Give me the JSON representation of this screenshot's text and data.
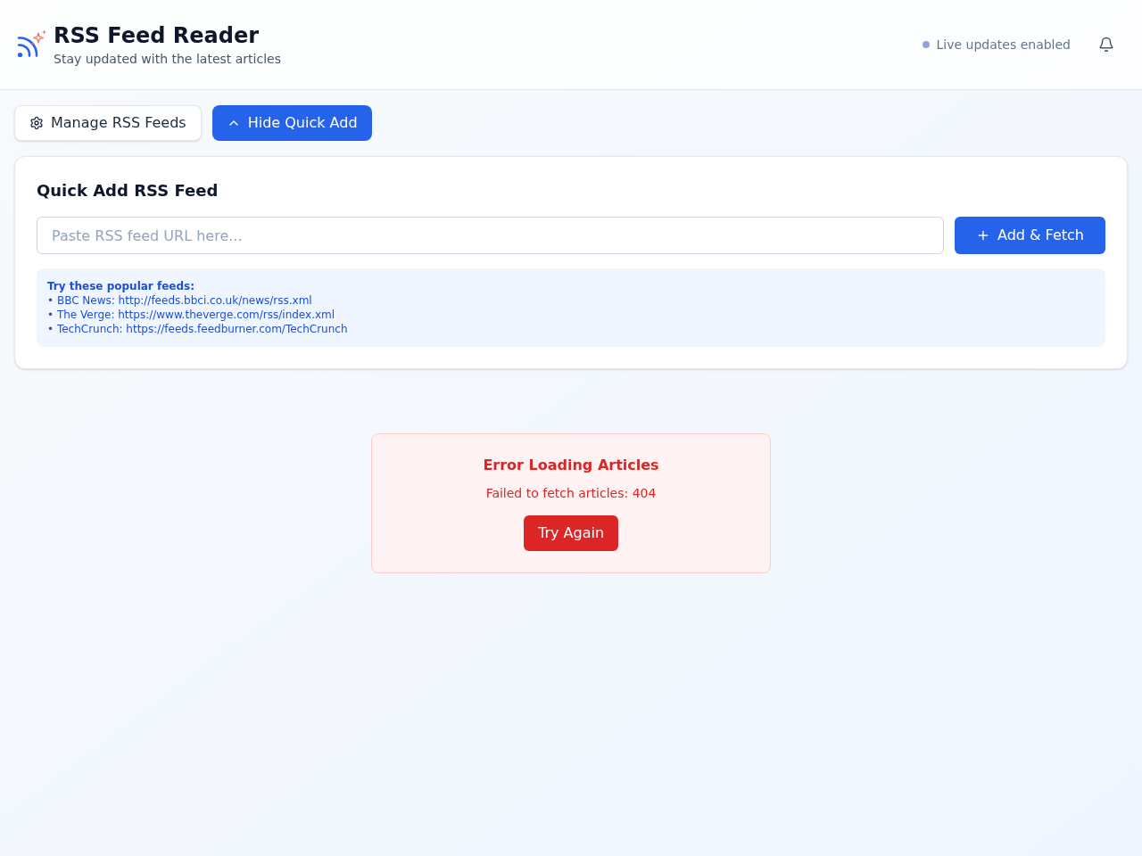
{
  "header": {
    "title": "RSS Feed Reader",
    "subtitle": "Stay updated with the latest articles",
    "status": "Live updates enabled"
  },
  "toolbar": {
    "buttons": [
      {
        "label": "Manage RSS Feeds",
        "kind": "secondary"
      },
      {
        "label": "Hide Quick Add",
        "kind": "primary"
      }
    ]
  },
  "quick_add": {
    "title": "Quick Add RSS Feed",
    "url_field": {
      "placeholder": "Paste RSS feed URL here..."
    },
    "submit_button": "Add & Fetch",
    "tips": {
      "heading": "Try these popular feeds:",
      "items": [
        "• BBC News: http://feeds.bbci.co.uk/news/rss.xml",
        "• The Verge: https://www.theverge.com/rss/index.xml",
        "• TechCrunch: https://feeds.feedburner.com/TechCrunch"
      ]
    }
  },
  "error": {
    "title": "Error Loading Articles",
    "message": "Failed to fetch articles: 404",
    "retry_button": "Try Again"
  }
}
